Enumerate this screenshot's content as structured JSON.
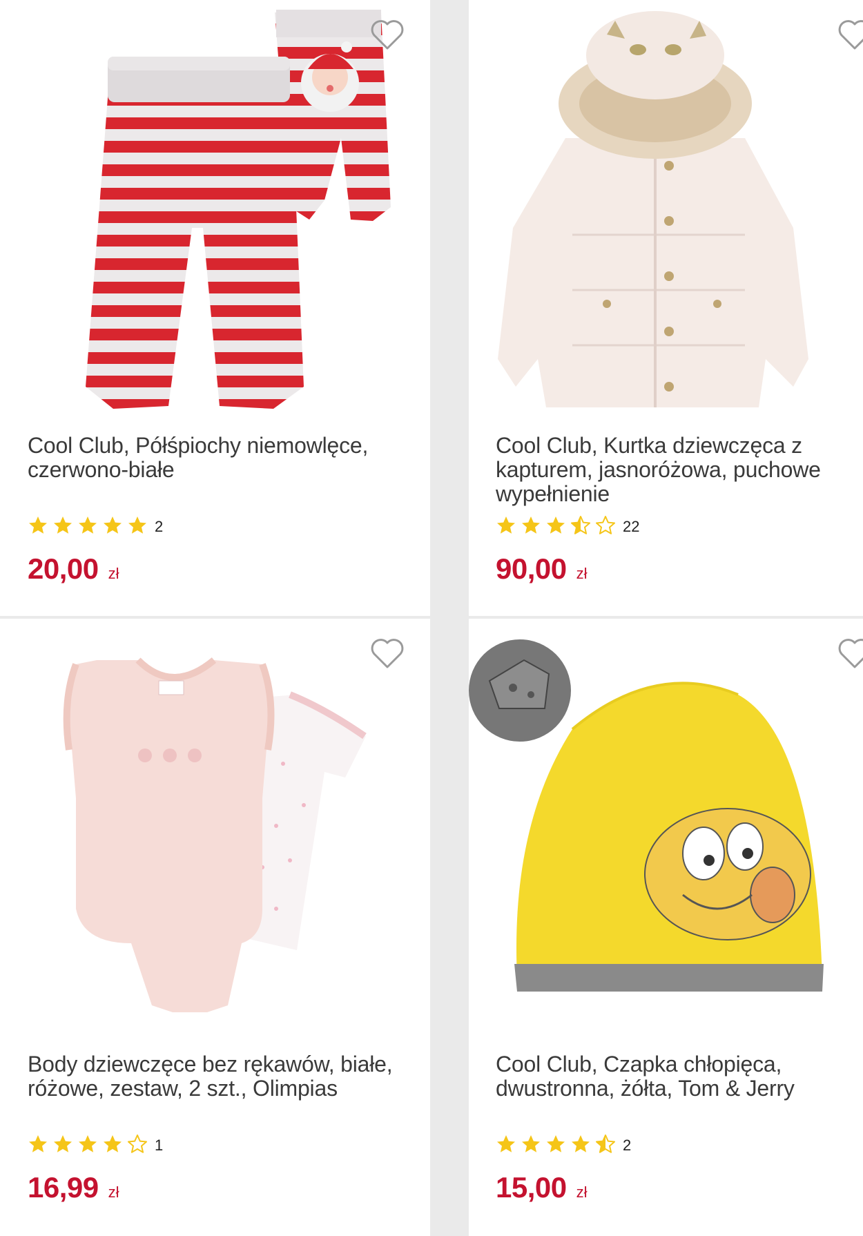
{
  "products": [
    {
      "title": "Cool Club, Półśpiochy niemowlęce, czerwono-białe",
      "rating": 5,
      "rating_count": "2",
      "price": "20,00",
      "currency": "zł",
      "image": "striped-baby-pants-image"
    },
    {
      "title": "Cool Club, Kurtka dziewczęca z kapturem, jasnoróżowa, puchowe wypełnienie",
      "rating": 3.5,
      "rating_count": "22",
      "price": "90,00",
      "currency": "zł",
      "image": "pink-hooded-jacket-image"
    },
    {
      "title": "Body dziewczęce bez rękawów, białe, różowe, zestaw, 2 szt., Olimpias",
      "rating": 4,
      "rating_count": "1",
      "price": "16,99",
      "currency": "zł",
      "image": "baby-bodysuits-image"
    },
    {
      "title": "Cool Club, Czapka chłopięca, dwustronna, żółta, Tom & Jerry",
      "rating": 4.5,
      "rating_count": "2",
      "price": "15,00",
      "currency": "zł",
      "image": "yellow-beanie-image"
    }
  ],
  "colors": {
    "price": "#c4122f",
    "star": "#f5c518",
    "divider": "#eaeaea"
  },
  "icons": {
    "favorite": "heart-outline-icon",
    "star_full": "star-filled-icon",
    "star_half": "star-half-icon",
    "star_empty": "star-outline-icon"
  }
}
